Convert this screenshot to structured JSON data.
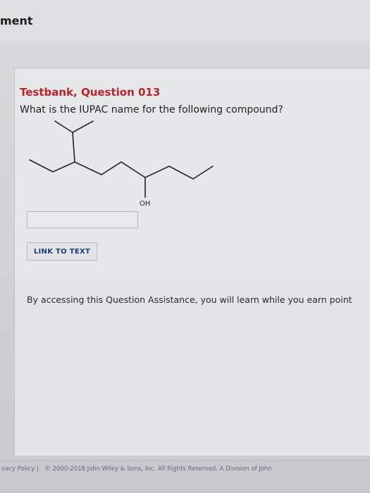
{
  "header": {
    "title": "ment"
  },
  "question": {
    "title": "Testbank, Question 013",
    "prompt": "What is the IUPAC name for the following compound?",
    "oh_label": "OH"
  },
  "answer": {
    "value": "",
    "placeholder": ""
  },
  "link_button": {
    "label": "LINK TO TEXT"
  },
  "assistance": {
    "text": "By accessing this Question Assistance, you will learn while you earn point"
  },
  "footer": {
    "privacy_label": "vacy Policy",
    "separator": "|",
    "copyright": "© 2000-2018 John Wiley & Sons, Inc. All Rights Reserved. A Division of John"
  },
  "colors": {
    "question_title": "#b8262a",
    "link_text": "#1f3c7a"
  }
}
